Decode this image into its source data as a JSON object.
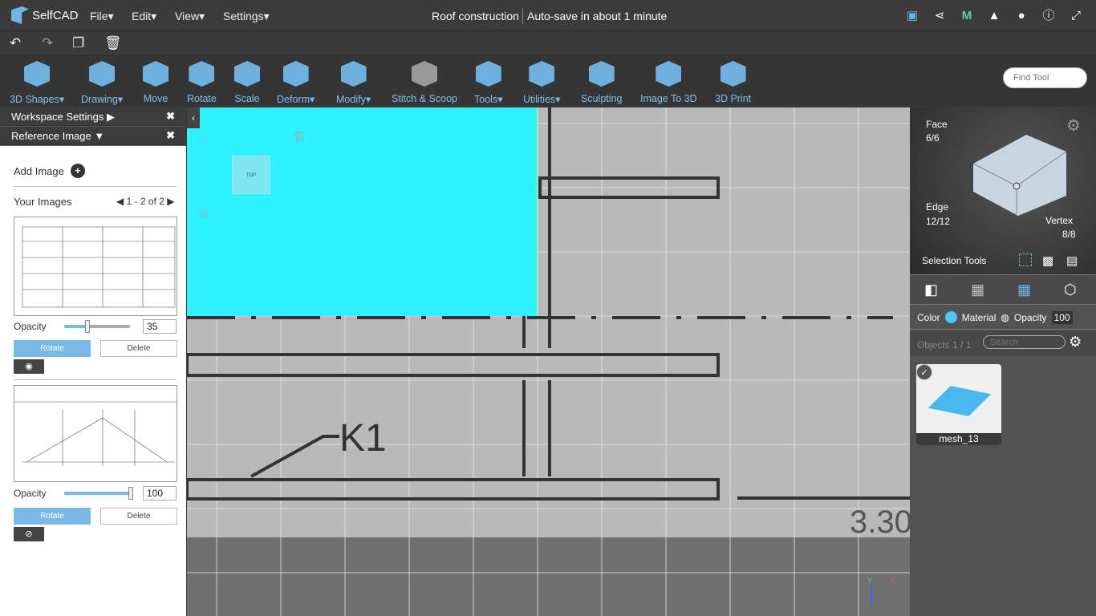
{
  "app": {
    "name": "SelfCAD",
    "project_title": "Roof construction",
    "autosave": "Auto-save in about 1 minute"
  },
  "menu": [
    "File",
    "Edit",
    "View",
    "Settings"
  ],
  "top_icons": [
    "save-icon",
    "share-icon",
    "m-icon",
    "bell-icon",
    "user-icon",
    "info-icon",
    "fullscreen-icon"
  ],
  "quick": [
    "undo-icon",
    "redo-icon",
    "copy-icon",
    "delete-icon"
  ],
  "tools": [
    {
      "label": "3D Shapes",
      "dd": true
    },
    {
      "label": "Drawing",
      "dd": true
    },
    {
      "label": "Move",
      "dd": false
    },
    {
      "label": "Rotate",
      "dd": false
    },
    {
      "label": "Scale",
      "dd": false
    },
    {
      "label": "Deform",
      "dd": true
    },
    {
      "label": "Modify",
      "dd": true
    },
    {
      "label": "Stitch & Scoop",
      "dd": false
    },
    {
      "label": "Tools",
      "dd": true
    },
    {
      "label": "Utilities",
      "dd": true
    },
    {
      "label": "Sculpting",
      "dd": false
    },
    {
      "label": "Image To 3D",
      "dd": false
    },
    {
      "label": "3D Print",
      "dd": false
    }
  ],
  "find_tool_placeholder": "Find Tool",
  "left": {
    "workspace_settings": "Workspace Settings",
    "reference_image": "Reference Image",
    "add_image": "Add Image",
    "your_images": "Your Images",
    "pager": "1 - 2 of 2",
    "images": [
      {
        "opacity_label": "Opacity",
        "opacity": 35,
        "rotate": "Rotate",
        "delete": "Delete",
        "visible": true
      },
      {
        "opacity_label": "Opacity",
        "opacity": 100,
        "rotate": "Rotate",
        "delete": "Delete",
        "visible": false
      }
    ]
  },
  "viewport": {
    "top_label": "TOP",
    "drawing_text": "K1",
    "drawing_text2": "3.30",
    "axis_x": "X",
    "axis_y": "Y",
    "overlay_color": "#2ef2fd"
  },
  "right": {
    "face_label": "Face",
    "face_count": "6/6",
    "edge_label": "Edge",
    "edge_count": "12/12",
    "vertex_label": "Vertex",
    "vertex_count": "8/8",
    "selection_tools": "Selection Tools",
    "color_label": "Color",
    "color": "#4ac8f5",
    "material_label": "Material",
    "opacity_label": "Opacity",
    "opacity": "100",
    "objects_label": "Objects 1 / 1",
    "search_placeholder": "Search",
    "object_name": "mesh_13"
  }
}
